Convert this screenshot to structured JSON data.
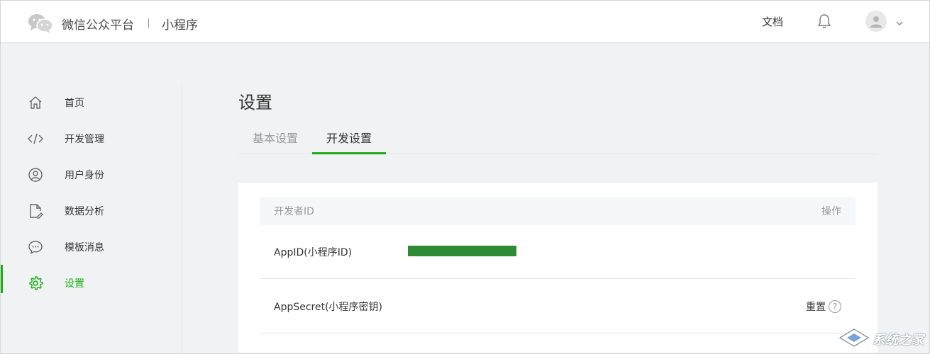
{
  "header": {
    "brand_title": "微信公众平台",
    "brand_sub": "小程序",
    "doc_link": "文档"
  },
  "sidebar": {
    "items": [
      {
        "label": "首页",
        "icon": "home-icon"
      },
      {
        "label": "开发管理",
        "icon": "code-icon"
      },
      {
        "label": "用户身份",
        "icon": "user-circle-icon"
      },
      {
        "label": "数据分析",
        "icon": "document-edit-icon"
      },
      {
        "label": "模板消息",
        "icon": "chat-bubble-icon"
      },
      {
        "label": "设置",
        "icon": "gear-icon",
        "active": true
      }
    ]
  },
  "main": {
    "title": "设置",
    "tabs": [
      {
        "label": "基本设置",
        "active": false
      },
      {
        "label": "开发设置",
        "active": true
      }
    ],
    "table": {
      "header_left": "开发者ID",
      "header_right": "操作",
      "rows": [
        {
          "key": "AppID(小程序ID)",
          "value_redacted": true
        },
        {
          "key": "AppSecret(小程序密钥)",
          "action": "重置"
        }
      ]
    }
  },
  "watermark": {
    "text": "系统之家"
  },
  "colors": {
    "accent": "#1aad19",
    "redaction": "#2e8a32"
  }
}
